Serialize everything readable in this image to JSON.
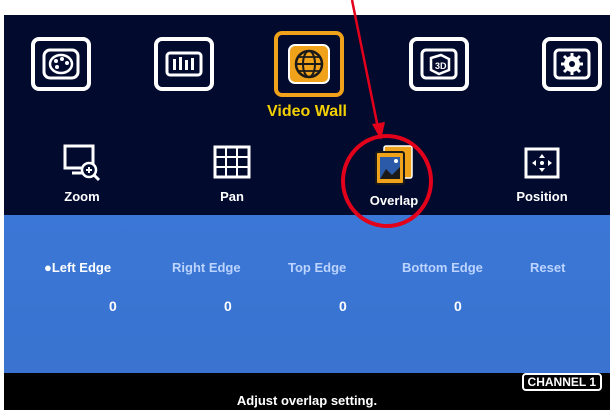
{
  "menu": {
    "icons": [
      "picture-icon",
      "equalizer-icon",
      "video-wall-icon",
      "3d-icon",
      "gear-icon"
    ],
    "selected_index": 2,
    "title": "Video Wall"
  },
  "submenu": {
    "items": [
      {
        "label": "Zoom",
        "icon": "zoom-monitor-icon"
      },
      {
        "label": "Pan",
        "icon": "pan-grid-icon"
      },
      {
        "label": "Overlap",
        "icon": "overlap-icon"
      },
      {
        "label": "Position",
        "icon": "position-icon"
      }
    ],
    "selected": "Overlap"
  },
  "options": {
    "items": [
      "Left Edge",
      "Right Edge",
      "Top Edge",
      "Bottom Edge",
      "Reset"
    ],
    "active_marker": "●",
    "active_index": 0,
    "values": [
      "0",
      "0",
      "0",
      "0"
    ]
  },
  "footer": {
    "status": "Adjust overlap setting.",
    "channel": "CHANNEL 1"
  },
  "colors": {
    "background": "#020a2e",
    "panel": "#3b77d6",
    "title": "#f4d000",
    "selected_border": "#f0a21a",
    "annotation": "#e3001b"
  }
}
